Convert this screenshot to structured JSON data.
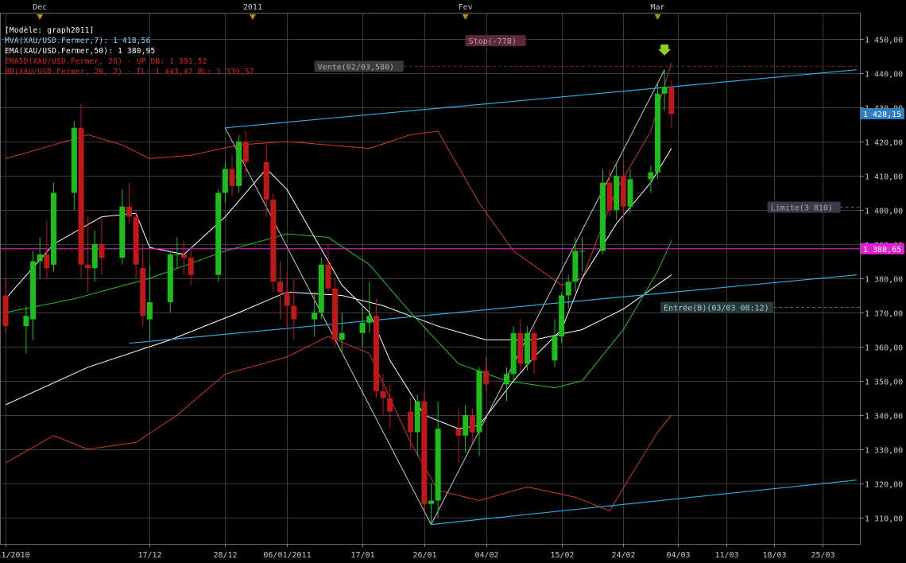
{
  "legend": {
    "model": "[Modèle: graph2011]",
    "mva": "MVA(XAU/USD.Fermer,7): 1 418,56",
    "ema": "EMA(XAU/USD.Fermer,50): 1 380,95",
    "ema5d": "EMA5D(XAU/USD.Fermer, 20) - UP DN: 1 391,52",
    "bb": "BB(XAU/USD.Fermer, 20, 2) - TL: 1 443,47 BL: 1 339,57"
  },
  "colors": {
    "background": "#000000",
    "grid": "#3a3a3a",
    "up": "#1bbf1b",
    "down": "#c01818",
    "mva": "#ffffff",
    "ema": "#ffffff",
    "ema5d": "#22c022",
    "bb": "#d23a1e",
    "trendline": "#2fa9e6",
    "zigzag": "#c8c8c8",
    "price_tag": "#2e7fc4",
    "magenta": "#e020d0"
  },
  "chart_data": {
    "type": "candlestick",
    "instrument": "XAU/USD",
    "ylim": [
      1302,
      1462
    ],
    "y_ticks": [
      1310,
      1320,
      1330,
      1340,
      1350,
      1360,
      1370,
      1380,
      1390,
      1400,
      1410,
      1420,
      1430,
      1440,
      1450
    ],
    "y_tick_labels": [
      "1 310,00",
      "1 320,00",
      "1 330,00",
      "1 340,00",
      "1 350,00",
      "1 360,00",
      "1 370,00",
      "1 380,00",
      "1 390,00",
      "1 400,00",
      "1 410,00",
      "1 420,00",
      "1 430,00",
      "1 440,00",
      "1 450,00"
    ],
    "x_start": "2010-11-26",
    "x_end": "2011-03-30",
    "x_ticks": [
      {
        "date": "2010-11-26",
        "label": "26/11/2010"
      },
      {
        "date": "2010-12-17",
        "label": "17/12"
      },
      {
        "date": "2010-12-28",
        "label": "28/12"
      },
      {
        "date": "2011-01-06",
        "label": "06/01/2011"
      },
      {
        "date": "2011-01-17",
        "label": "17/01"
      },
      {
        "date": "2011-01-26",
        "label": "26/01"
      },
      {
        "date": "2011-02-04",
        "label": "04/02"
      },
      {
        "date": "2011-02-15",
        "label": "15/02"
      },
      {
        "date": "2011-02-24",
        "label": "24/02"
      },
      {
        "date": "2011-03-04",
        "label": "04/03"
      },
      {
        "date": "2011-03-11",
        "label": "11/03"
      },
      {
        "date": "2011-03-18",
        "label": "18/03"
      },
      {
        "date": "2011-03-25",
        "label": "25/03"
      }
    ],
    "month_markers": [
      {
        "date": "2010-12-01",
        "label": "Dec"
      },
      {
        "date": "2011-01-01",
        "label": "2011"
      },
      {
        "date": "2011-02-01",
        "label": "Fev"
      },
      {
        "date": "2011-03-01",
        "label": "Mar"
      }
    ],
    "candles": [
      {
        "d": "2010-11-26",
        "o": 1375,
        "h": 1380,
        "l": 1364,
        "c": 1366
      },
      {
        "d": "2010-11-29",
        "o": 1366,
        "h": 1372,
        "l": 1358,
        "c": 1369
      },
      {
        "d": "2010-11-30",
        "o": 1368,
        "h": 1388,
        "l": 1362,
        "c": 1385
      },
      {
        "d": "2010-12-01",
        "o": 1385,
        "h": 1392,
        "l": 1380,
        "c": 1387
      },
      {
        "d": "2010-12-02",
        "o": 1387,
        "h": 1397,
        "l": 1380,
        "c": 1383
      },
      {
        "d": "2010-12-03",
        "o": 1384,
        "h": 1408,
        "l": 1382,
        "c": 1405
      },
      {
        "d": "2010-12-06",
        "o": 1405,
        "h": 1426,
        "l": 1400,
        "c": 1424
      },
      {
        "d": "2010-12-07",
        "o": 1424,
        "h": 1431,
        "l": 1380,
        "c": 1384
      },
      {
        "d": "2010-12-08",
        "o": 1384,
        "h": 1398,
        "l": 1376,
        "c": 1383
      },
      {
        "d": "2010-12-09",
        "o": 1383,
        "h": 1394,
        "l": 1379,
        "c": 1390
      },
      {
        "d": "2010-12-10",
        "o": 1390,
        "h": 1398,
        "l": 1381,
        "c": 1386
      },
      {
        "d": "2010-12-13",
        "o": 1386,
        "h": 1406,
        "l": 1384,
        "c": 1401
      },
      {
        "d": "2010-12-14",
        "o": 1401,
        "h": 1408,
        "l": 1396,
        "c": 1398
      },
      {
        "d": "2010-12-15",
        "o": 1398,
        "h": 1400,
        "l": 1380,
        "c": 1384
      },
      {
        "d": "2010-12-16",
        "o": 1383,
        "h": 1390,
        "l": 1366,
        "c": 1369
      },
      {
        "d": "2010-12-17",
        "o": 1368,
        "h": 1384,
        "l": 1362,
        "c": 1373
      },
      {
        "d": "2010-12-20",
        "o": 1373,
        "h": 1388,
        "l": 1370,
        "c": 1387
      },
      {
        "d": "2010-12-21",
        "o": 1387,
        "h": 1392,
        "l": 1383,
        "c": 1387
      },
      {
        "d": "2010-12-22",
        "o": 1387,
        "h": 1391,
        "l": 1381,
        "c": 1386
      },
      {
        "d": "2010-12-23",
        "o": 1386,
        "h": 1389,
        "l": 1378,
        "c": 1381
      },
      {
        "d": "2010-12-27",
        "o": 1381,
        "h": 1406,
        "l": 1379,
        "c": 1405
      },
      {
        "d": "2010-12-28",
        "o": 1405,
        "h": 1414,
        "l": 1402,
        "c": 1412
      },
      {
        "d": "2010-12-29",
        "o": 1412,
        "h": 1416,
        "l": 1404,
        "c": 1407
      },
      {
        "d": "2010-12-30",
        "o": 1407,
        "h": 1422,
        "l": 1405,
        "c": 1420
      },
      {
        "d": "2010-12-31",
        "o": 1420,
        "h": 1423,
        "l": 1410,
        "c": 1414
      },
      {
        "d": "2011-01-03",
        "o": 1414,
        "h": 1419,
        "l": 1398,
        "c": 1403
      },
      {
        "d": "2011-01-04",
        "o": 1403,
        "h": 1405,
        "l": 1376,
        "c": 1379
      },
      {
        "d": "2011-01-05",
        "o": 1379,
        "h": 1385,
        "l": 1368,
        "c": 1376
      },
      {
        "d": "2011-01-06",
        "o": 1376,
        "h": 1382,
        "l": 1365,
        "c": 1372
      },
      {
        "d": "2011-01-07",
        "o": 1372,
        "h": 1380,
        "l": 1362,
        "c": 1368
      },
      {
        "d": "2011-01-10",
        "o": 1368,
        "h": 1376,
        "l": 1363,
        "c": 1370
      },
      {
        "d": "2011-01-11",
        "o": 1370,
        "h": 1386,
        "l": 1368,
        "c": 1384
      },
      {
        "d": "2011-01-12",
        "o": 1384,
        "h": 1390,
        "l": 1376,
        "c": 1377
      },
      {
        "d": "2011-01-13",
        "o": 1377,
        "h": 1380,
        "l": 1360,
        "c": 1362
      },
      {
        "d": "2011-01-14",
        "o": 1362,
        "h": 1370,
        "l": 1358,
        "c": 1364
      },
      {
        "d": "2011-01-17",
        "o": 1364,
        "h": 1372,
        "l": 1360,
        "c": 1367
      },
      {
        "d": "2011-01-18",
        "o": 1367,
        "h": 1379,
        "l": 1364,
        "c": 1369
      },
      {
        "d": "2011-01-19",
        "o": 1369,
        "h": 1374,
        "l": 1345,
        "c": 1347
      },
      {
        "d": "2011-01-20",
        "o": 1347,
        "h": 1352,
        "l": 1340,
        "c": 1345
      },
      {
        "d": "2011-01-21",
        "o": 1345,
        "h": 1349,
        "l": 1336,
        "c": 1341
      },
      {
        "d": "2011-01-24",
        "o": 1341,
        "h": 1345,
        "l": 1330,
        "c": 1335
      },
      {
        "d": "2011-01-25",
        "o": 1335,
        "h": 1346,
        "l": 1328,
        "c": 1344
      },
      {
        "d": "2011-01-26",
        "o": 1344,
        "h": 1347,
        "l": 1312,
        "c": 1314
      },
      {
        "d": "2011-01-27",
        "o": 1314,
        "h": 1320,
        "l": 1308,
        "c": 1315
      },
      {
        "d": "2011-01-28",
        "o": 1315,
        "h": 1344,
        "l": 1310,
        "c": 1336
      },
      {
        "d": "2011-01-31",
        "o": 1336,
        "h": 1342,
        "l": 1326,
        "c": 1334
      },
      {
        "d": "2011-02-01",
        "o": 1334,
        "h": 1343,
        "l": 1329,
        "c": 1340
      },
      {
        "d": "2011-02-02",
        "o": 1340,
        "h": 1342,
        "l": 1332,
        "c": 1335
      },
      {
        "d": "2011-02-03",
        "o": 1335,
        "h": 1354,
        "l": 1328,
        "c": 1353
      },
      {
        "d": "2011-02-04",
        "o": 1353,
        "h": 1357,
        "l": 1347,
        "c": 1349
      },
      {
        "d": "2011-02-07",
        "o": 1349,
        "h": 1354,
        "l": 1344,
        "c": 1352
      },
      {
        "d": "2011-02-08",
        "o": 1352,
        "h": 1366,
        "l": 1350,
        "c": 1364
      },
      {
        "d": "2011-02-09",
        "o": 1364,
        "h": 1368,
        "l": 1353,
        "c": 1355
      },
      {
        "d": "2011-02-10",
        "o": 1355,
        "h": 1366,
        "l": 1353,
        "c": 1364
      },
      {
        "d": "2011-02-11",
        "o": 1364,
        "h": 1366,
        "l": 1352,
        "c": 1356
      },
      {
        "d": "2011-02-14",
        "o": 1356,
        "h": 1368,
        "l": 1354,
        "c": 1363
      },
      {
        "d": "2011-02-15",
        "o": 1363,
        "h": 1376,
        "l": 1361,
        "c": 1375
      },
      {
        "d": "2011-02-16",
        "o": 1375,
        "h": 1381,
        "l": 1371,
        "c": 1379
      },
      {
        "d": "2011-02-17",
        "o": 1379,
        "h": 1392,
        "l": 1376,
        "c": 1388
      },
      {
        "d": "2011-02-18",
        "o": 1388,
        "h": 1392,
        "l": 1382,
        "c": 1388
      },
      {
        "d": "2011-02-21",
        "o": 1388,
        "h": 1412,
        "l": 1387,
        "c": 1408
      },
      {
        "d": "2011-02-22",
        "o": 1408,
        "h": 1412,
        "l": 1398,
        "c": 1400
      },
      {
        "d": "2011-02-23",
        "o": 1400,
        "h": 1414,
        "l": 1397,
        "c": 1410
      },
      {
        "d": "2011-02-24",
        "o": 1410,
        "h": 1415,
        "l": 1396,
        "c": 1401
      },
      {
        "d": "2011-02-25",
        "o": 1401,
        "h": 1412,
        "l": 1399,
        "c": 1409
      },
      {
        "d": "2011-02-28",
        "o": 1409,
        "h": 1413,
        "l": 1405,
        "c": 1411
      },
      {
        "d": "2011-03-01",
        "o": 1411,
        "h": 1437,
        "l": 1409,
        "c": 1434
      },
      {
        "d": "2011-03-02",
        "o": 1434,
        "h": 1441,
        "l": 1429,
        "c": 1436
      },
      {
        "d": "2011-03-03",
        "o": 1436,
        "h": 1438,
        "l": 1424,
        "c": 1428
      }
    ],
    "mva_7": [
      [
        "2010-11-26",
        1374
      ],
      [
        "2010-12-03",
        1390
      ],
      [
        "2010-12-10",
        1398
      ],
      [
        "2010-12-15",
        1399
      ],
      [
        "2010-12-17",
        1389
      ],
      [
        "2010-12-22",
        1387
      ],
      [
        "2010-12-28",
        1398
      ],
      [
        "2011-01-03",
        1412
      ],
      [
        "2011-01-06",
        1406
      ],
      [
        "2011-01-10",
        1392
      ],
      [
        "2011-01-14",
        1378
      ],
      [
        "2011-01-18",
        1370
      ],
      [
        "2011-01-21",
        1356
      ],
      [
        "2011-01-26",
        1340
      ],
      [
        "2011-01-31",
        1336
      ],
      [
        "2011-02-03",
        1337
      ],
      [
        "2011-02-08",
        1350
      ],
      [
        "2011-02-11",
        1357
      ],
      [
        "2011-02-15",
        1365
      ],
      [
        "2011-02-18",
        1380
      ],
      [
        "2011-02-23",
        1396
      ],
      [
        "2011-02-28",
        1408
      ],
      [
        "2011-03-03",
        1418
      ]
    ],
    "ema_50": [
      [
        "2010-11-26",
        1343
      ],
      [
        "2010-12-08",
        1354
      ],
      [
        "2010-12-20",
        1362
      ],
      [
        "2010-12-30",
        1370
      ],
      [
        "2011-01-06",
        1376
      ],
      [
        "2011-01-14",
        1375
      ],
      [
        "2011-01-20",
        1372
      ],
      [
        "2011-01-28",
        1366
      ],
      [
        "2011-02-04",
        1362
      ],
      [
        "2011-02-11",
        1362
      ],
      [
        "2011-02-18",
        1365
      ],
      [
        "2011-02-24",
        1371
      ],
      [
        "2011-03-03",
        1381
      ]
    ],
    "ema5d_20": [
      [
        "2010-11-26",
        1370
      ],
      [
        "2010-12-06",
        1374
      ],
      [
        "2010-12-17",
        1380
      ],
      [
        "2010-12-28",
        1388
      ],
      [
        "2011-01-06",
        1393
      ],
      [
        "2011-01-12",
        1392
      ],
      [
        "2011-01-18",
        1384
      ],
      [
        "2011-01-24",
        1370
      ],
      [
        "2011-01-31",
        1355
      ],
      [
        "2011-02-07",
        1350
      ],
      [
        "2011-02-14",
        1348
      ],
      [
        "2011-02-18",
        1350
      ],
      [
        "2011-02-24",
        1365
      ],
      [
        "2011-03-01",
        1382
      ],
      [
        "2011-03-03",
        1391
      ]
    ],
    "bb_upper": [
      [
        "2010-11-26",
        1415
      ],
      [
        "2010-12-03",
        1419
      ],
      [
        "2010-12-08",
        1422
      ],
      [
        "2010-12-13",
        1419
      ],
      [
        "2010-12-17",
        1415
      ],
      [
        "2010-12-23",
        1416
      ],
      [
        "2010-12-30",
        1419
      ],
      [
        "2011-01-06",
        1420
      ],
      [
        "2011-01-12",
        1419
      ],
      [
        "2011-01-18",
        1418
      ],
      [
        "2011-01-24",
        1422
      ],
      [
        "2011-01-28",
        1423
      ],
      [
        "2011-02-03",
        1402
      ],
      [
        "2011-02-08",
        1388
      ],
      [
        "2011-02-15",
        1378
      ],
      [
        "2011-02-18",
        1380
      ],
      [
        "2011-02-23",
        1406
      ],
      [
        "2011-02-28",
        1423
      ],
      [
        "2011-03-03",
        1443
      ]
    ],
    "bb_lower": [
      [
        "2010-11-26",
        1326
      ],
      [
        "2010-12-03",
        1334
      ],
      [
        "2010-12-08",
        1330
      ],
      [
        "2010-12-15",
        1332
      ],
      [
        "2010-12-21",
        1340
      ],
      [
        "2010-12-28",
        1352
      ],
      [
        "2011-01-06",
        1357
      ],
      [
        "2011-01-12",
        1363
      ],
      [
        "2011-01-18",
        1358
      ],
      [
        "2011-01-24",
        1332
      ],
      [
        "2011-01-28",
        1318
      ],
      [
        "2011-02-03",
        1315
      ],
      [
        "2011-02-10",
        1319
      ],
      [
        "2011-02-17",
        1316
      ],
      [
        "2011-02-22",
        1312
      ],
      [
        "2011-02-25",
        1322
      ],
      [
        "2011-03-01",
        1335
      ],
      [
        "2011-03-03",
        1340
      ]
    ],
    "trendlines": [
      {
        "from": [
          "2010-12-28",
          1424
        ],
        "to": [
          "2011-03-30",
          1441
        ]
      },
      {
        "from": [
          "2010-12-14",
          1361
        ],
        "to": [
          "2011-03-30",
          1381
        ]
      },
      {
        "from": [
          "2011-01-27",
          1308
        ],
        "to": [
          "2011-03-30",
          1321
        ]
      }
    ],
    "zigzag": [
      [
        "2010-12-28",
        1424
      ],
      [
        "2011-01-27",
        1308
      ],
      [
        "2011-03-02",
        1441
      ]
    ],
    "orders": {
      "stop": {
        "label": "Stop(-778)",
        "price": 1449.5,
        "date": "2011-02-01"
      },
      "vente": {
        "label": "Vente(02/03,580)",
        "price": 1442.0,
        "date": "2011-01-10"
      },
      "limite": {
        "label": "Limite(3 810)",
        "price": 1400.8,
        "date": "2011-03-17"
      },
      "entree": {
        "label": "Entrée(B)(03/03 08:12)",
        "price": 1371.5,
        "date": "2011-03-13"
      }
    },
    "price_tag": {
      "label": "1 428,15",
      "price": 1428.15
    },
    "magenta_tag": {
      "label": "1 388,65",
      "price": 1388.65
    }
  }
}
